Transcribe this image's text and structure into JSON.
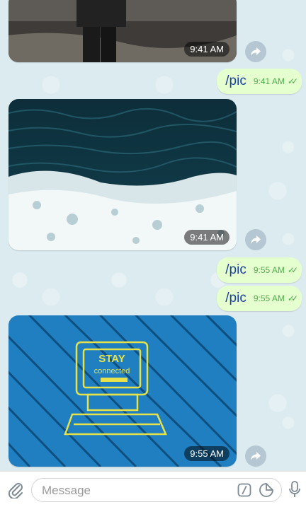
{
  "messages": [
    {
      "type": "photo",
      "time": "9:41 AM"
    },
    {
      "type": "text",
      "text": "/pic",
      "time": "9:41 AM"
    },
    {
      "type": "photo",
      "time": "9:41 AM"
    },
    {
      "type": "text",
      "text": "/pic",
      "time": "9:55 AM"
    },
    {
      "type": "text",
      "text": "/pic",
      "time": "9:55 AM"
    },
    {
      "type": "photo",
      "time": "9:55 AM",
      "wall_text": [
        "STAY",
        "connected"
      ]
    }
  ],
  "composer": {
    "placeholder": "Message"
  },
  "icons": {
    "attach": "paperclip-icon",
    "command": "slash-command-icon",
    "sticker": "sticker-icon",
    "mic": "microphone-icon",
    "share": "share-arrow-icon"
  },
  "colors": {
    "outgoing_bubble": "#e6ffce",
    "outgoing_text": "#1a3fa0",
    "outgoing_meta": "#4fae4e"
  }
}
